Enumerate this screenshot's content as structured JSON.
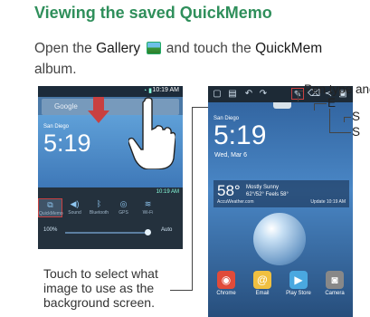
{
  "heading": "Viewing the saved QuickMemo",
  "instruction": {
    "part1": "Open the ",
    "gallery": "Gallery",
    "part2": " and touch the ",
    "quickmemo": "QuickMem",
    "line2": "album."
  },
  "left_phone": {
    "status_time": "10:19 AM",
    "search_text": "Google",
    "city": "San Diego",
    "clock": "5:19",
    "panel_status": "10:19 AM",
    "tiles": [
      {
        "label": "QuickMemo",
        "icon": "quickmemo-icon",
        "selected": true
      },
      {
        "label": "Sound",
        "icon": "sound-icon",
        "selected": false
      },
      {
        "label": "Bluetooth",
        "icon": "bluetooth-icon",
        "selected": false
      },
      {
        "label": "GPS",
        "icon": "gps-icon",
        "selected": false
      },
      {
        "label": "Wi-Fi",
        "icon": "wifi-icon",
        "selected": false
      }
    ],
    "brightness_label": "100%",
    "auto_label": "Auto"
  },
  "caption_left": [
    "Touch to select what",
    "image to use as the",
    "background screen."
  ],
  "right_phone": {
    "city": "San Diego",
    "clock": "5:19",
    "date": "Wed, Mar 6",
    "temp": "58°",
    "condition": "Mostly Sunny",
    "condition_sub": "62°/52° Feels 58°",
    "brand": "AccuWeather.com",
    "updated": "Update 10:19 AM",
    "apps": [
      {
        "label": "Chrome",
        "color": "#e04b3a"
      },
      {
        "label": "Email",
        "color": "#f0c040"
      },
      {
        "label": "Play Store",
        "color": "#4aa8e0"
      },
      {
        "label": "Camera",
        "color": "#888888"
      }
    ]
  },
  "callouts": {
    "pen": "Pen type and C",
    "eraser": "E",
    "save": "S",
    "share": "S"
  },
  "colors": {
    "heading": "#2f8f5b",
    "highlight": "#c94040"
  }
}
